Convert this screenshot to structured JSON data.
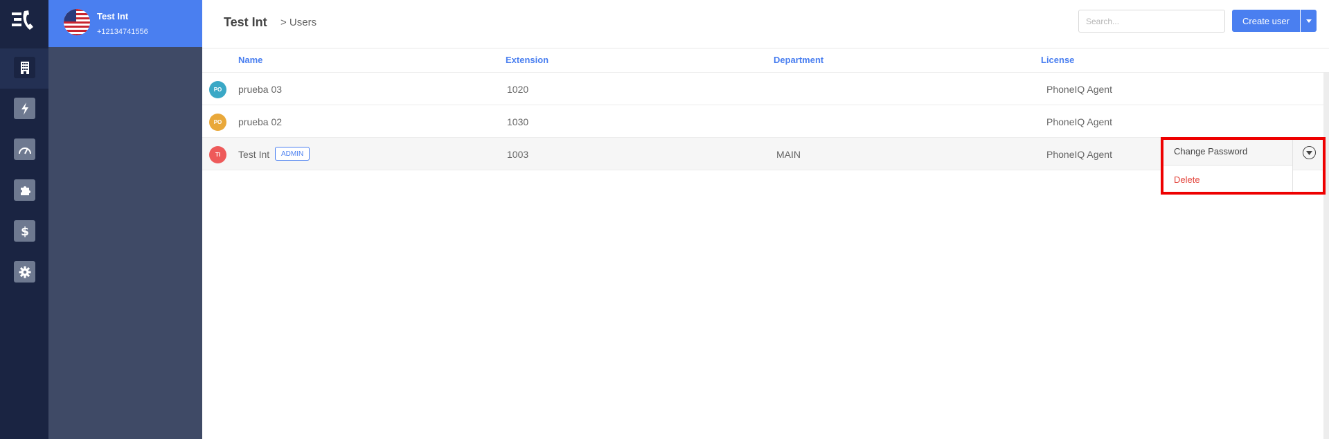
{
  "account": {
    "name": "Test Int",
    "phone": "+12134741556"
  },
  "nav": {
    "items": [
      {
        "icon": "building-icon",
        "active": true
      },
      {
        "icon": "lightning-icon",
        "active": false
      },
      {
        "icon": "speedometer-icon",
        "active": false
      },
      {
        "icon": "puzzle-icon",
        "active": false
      },
      {
        "icon": "dollar-icon",
        "active": false
      },
      {
        "icon": "gear-icon",
        "active": false
      }
    ]
  },
  "header": {
    "breadcrumb_root": "Test Int",
    "breadcrumb_rest": "> Users",
    "search_placeholder": "Search...",
    "create_label": "Create user"
  },
  "table": {
    "columns": [
      "Name",
      "Extension",
      "Department",
      "License"
    ],
    "rows": [
      {
        "initials": "PO",
        "avatar_color": "#3aa8c6",
        "name": "prueba 03",
        "extension": "1020",
        "department": "",
        "license": "PhoneIQ Agent",
        "badge": ""
      },
      {
        "initials": "PO",
        "avatar_color": "#e9a83a",
        "name": "prueba 02",
        "extension": "1030",
        "department": "",
        "license": "PhoneIQ Agent",
        "badge": ""
      },
      {
        "initials": "TI",
        "avatar_color": "#ee5a5a",
        "name": "Test Int",
        "extension": "1003",
        "department": "MAIN",
        "license": "PhoneIQ Agent",
        "badge": "ADMIN"
      }
    ]
  },
  "row_menu": {
    "change_password": "Change Password",
    "delete": "Delete"
  },
  "colors": {
    "accent": "#4a7ff0",
    "rail": "#1a2442",
    "panel": "#3f4a66",
    "danger": "#e3463d",
    "highlight": "#ee0000"
  }
}
